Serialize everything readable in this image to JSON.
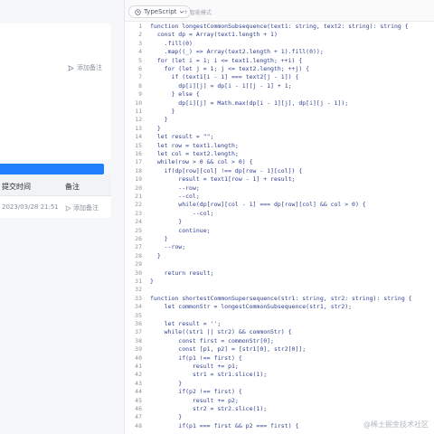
{
  "left_panel": {
    "add_note_label": "添加备注",
    "table": {
      "headers": [
        "提交时间",
        "备注"
      ],
      "rows": [
        {
          "time": "2023/03/28 21:51",
          "note": "添加备注"
        }
      ]
    }
  },
  "editor": {
    "language": "TypeScript",
    "smart_mode_label": "智能模式",
    "lines": [
      {
        "n": "1",
        "text": "function longestCommonSubsequence(text1: string, text2: string): string {"
      },
      {
        "n": "2",
        "text": "  const dp = Array(text1.length + 1)"
      },
      {
        "n": "3",
        "text": "    .fill(0)"
      },
      {
        "n": "4",
        "text": "    .map((_) => Array(text2.length + 1).fill(0));"
      },
      {
        "n": "5",
        "text": "  for (let i = 1; i <= text1.length; ++i) {"
      },
      {
        "n": "6",
        "text": "    for (let j = 1; j <= text2.length; ++j) {"
      },
      {
        "n": "7",
        "text": "      if (text1[i - 1] === text2[j - 1]) {"
      },
      {
        "n": "8",
        "text": "        dp[i][j] = dp[i - 1][j - 1] + 1;"
      },
      {
        "n": "9",
        "text": "      } else {"
      },
      {
        "n": "10",
        "text": "        dp[i][j] = Math.max(dp[i - 1][j], dp[i][j - 1]);"
      },
      {
        "n": "11",
        "text": "      }"
      },
      {
        "n": "12",
        "text": "    }"
      },
      {
        "n": "13",
        "text": "  }"
      },
      {
        "n": "14",
        "text": "  let result = \"\";"
      },
      {
        "n": "15",
        "text": "  let row = text1.length;"
      },
      {
        "n": "16",
        "text": "  let col = text2.length;"
      },
      {
        "n": "17",
        "text": "  while(row > 0 && col > 0) {"
      },
      {
        "n": "18",
        "text": "    if(dp[row][col] !== dp[row - 1][col]) {"
      },
      {
        "n": "19",
        "text": "        result = text1[row - 1] + result;"
      },
      {
        "n": "20",
        "text": "        --row;"
      },
      {
        "n": "21",
        "text": "        --col;"
      },
      {
        "n": "22",
        "text": "        while(dp[row][col - 1] === dp[row][col] && col > 0) {"
      },
      {
        "n": "23",
        "text": "            --col;"
      },
      {
        "n": "24",
        "text": "        }"
      },
      {
        "n": "25",
        "text": "        continue;"
      },
      {
        "n": "26",
        "text": "    }"
      },
      {
        "n": "27",
        "text": "    --row;"
      },
      {
        "n": "28",
        "text": "  }"
      },
      {
        "n": "29",
        "text": ""
      },
      {
        "n": "30",
        "text": "    return result;"
      },
      {
        "n": "31",
        "text": "}"
      },
      {
        "n": "32",
        "text": ""
      },
      {
        "n": "33",
        "text": "function shortestCommonSupersequence(str1: string, str2: string): string {"
      },
      {
        "n": "34",
        "text": "    let commonStr = longestCommonSubsequence(str1, str2);"
      },
      {
        "n": "35",
        "text": ""
      },
      {
        "n": "36",
        "text": "    let result = '';"
      },
      {
        "n": "37",
        "text": "    while((str1 || str2) && commonStr) {"
      },
      {
        "n": "38",
        "text": "        const first = commonStr[0];"
      },
      {
        "n": "39",
        "text": "        const [p1, p2] = [str1[0], str2[0]];"
      },
      {
        "n": "40",
        "text": "        if(p1 !== first) {"
      },
      {
        "n": "41",
        "text": "            result += p1;"
      },
      {
        "n": "42",
        "text": "            str1 = str1.slice(1);"
      },
      {
        "n": "43",
        "text": "        }"
      },
      {
        "n": "44",
        "text": "        if(p2 !== first) {"
      },
      {
        "n": "45",
        "text": "            result += p2;"
      },
      {
        "n": "46",
        "text": "            str2 = str2.slice(1);"
      },
      {
        "n": "47",
        "text": "        }"
      },
      {
        "n": "48",
        "text": "        if(p1 === first && p2 === first) {"
      }
    ]
  },
  "watermark": "@稀土掘金技术社区",
  "colors": {
    "accent": "#1e80ff",
    "code_text": "#2f3f8f",
    "line_number": "#8e939a"
  }
}
